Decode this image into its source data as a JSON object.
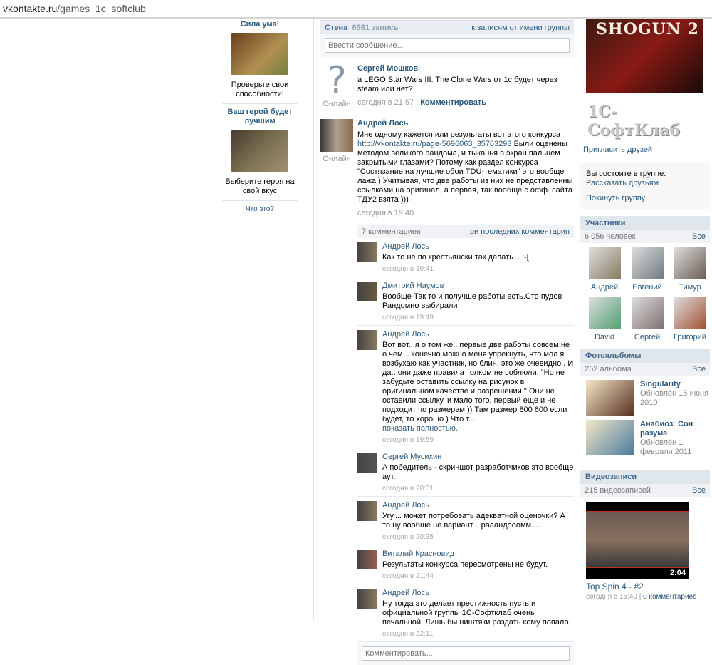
{
  "address_bar": {
    "host": "vkontakte.ru",
    "path": "/games_1c_softclub"
  },
  "ads": [
    {
      "title": "Сила ума!",
      "text": "Проверьте свои способности!",
      "color": "#8a7040"
    },
    {
      "title": "Ваш герой будет лучшим",
      "text": "Выберите героя на свой вкус",
      "color": "#5a5040"
    }
  ],
  "ads_help": "Что это?",
  "wall": {
    "title": "Стена",
    "count": "6981 запись",
    "group_posts_link": "к записям от имени группы",
    "input_placeholder": "Ввести сообщение...",
    "posts": [
      {
        "author": "Сергей Мошков",
        "status": "Онлайн",
        "avatar": "?",
        "text": "а LEGO Star Wars III: The Clone Wars от  1c будет через steam или нет?",
        "time": "сегодня в 21:57",
        "comment_link": "Комментировать"
      },
      {
        "author": "Андрей Лось",
        "status": "Онлайн",
        "text_before": "Мне одному кажется или результаты вот этого конкурса ",
        "link": "http://vkontakte.ru/page-5696063_35763293",
        "text_after": " Были оценены методом великого рандома, и тыканья в экран пальцем закрытыми глазами? Потому как раздел конкурса \"Состязание на лучшие обои TDU-тематики\" это вообще лажа ) Учитывая, что две работы из них не представленны ссылками на оригинал, а первая, так вообще с офф. сайта ТДУ2 взята )))",
        "time": "сегодня в 19:40"
      }
    ],
    "replies_header": {
      "count": "7 комментариев",
      "last_link": "три последних комментария"
    },
    "replies": [
      {
        "author": "Андрей Лось",
        "text": "Как то не по крестьянски так делать... :-[",
        "time": "сегодня в 19:41",
        "color": "#8a7a60"
      },
      {
        "author": "Дмитрий Наумов",
        "text": "Вообще Так то и получше работы есть.Сто пудов Рандомно выбирали",
        "time": "сегодня в 19:49",
        "color": "#6a5a40"
      },
      {
        "author": "Андрей Лось",
        "text": "Вот вот.. я о том же.. первые две работы совсем не о чем... конечно можно меня упрекнуть, что мол я возбухаю как участник, но блин, это же очевидно.. И да.. они даже правила толком не соблюли. \"Но не забудьте оставить ссылку на рисунок в оригинальном качестве и разрешении \" Они не оставили ссылку, и мало того, первый еще и не подходит по размерам )) Там размер 800 600 если будет, то хорошо ) Что т...",
        "more": "показать полностью..",
        "time": "сегодня в 19:59",
        "color": "#8a7a60"
      },
      {
        "author": "Сергей Мусихин",
        "text": "А победитель - скриншот разработчиков это вообще аут.",
        "time": "сегодня в 20:31",
        "color": "#555555"
      },
      {
        "author": "Андрей Лось",
        "text": "Угу.... может потребовать адекватной оценочки? А то ну вообще не вариант... рааандооомм....",
        "time": "сегодня в 20:35",
        "color": "#8a7a60"
      },
      {
        "author": "Виталий Красновид",
        "text": "Результаты конкурса пересмотрены не будут.",
        "time": "сегодня в 21:44",
        "color": "#9a6050"
      },
      {
        "author": "Андрей Лось",
        "text": "Ну тогда это делает престижность пусть и официальной группы 1С-Софтклаб очень печальной. Лишь бы ништяки раздать кому попало.",
        "time": "сегодня в 22:11",
        "color": "#8a7a60"
      }
    ],
    "comment_placeholder": "Комментировать..."
  },
  "right": {
    "logo_title": "SHOGUN 2",
    "logo_brand": "1С-СофтКлаб",
    "invite": "Пригласить друзей",
    "membership": {
      "status": "Вы состоите в группе.",
      "tell": "Рассказать друзьям",
      "leave": "Покинуть группу"
    },
    "members": {
      "title": "Участники",
      "count": "6 056 человек",
      "all": "Все",
      "items": [
        {
          "name": "Андрей",
          "color": "#8a7a60"
        },
        {
          "name": "Евгений",
          "color": "#707a80"
        },
        {
          "name": "Тимур",
          "color": "#6a5a50"
        },
        {
          "name": "David",
          "color": "#50a070"
        },
        {
          "name": "Сергей",
          "color": "#807070"
        },
        {
          "name": "Григорий",
          "color": "#a05030"
        }
      ]
    },
    "albums": {
      "title": "Фотоальбомы",
      "count": "252 альбома",
      "all": "Все",
      "items": [
        {
          "name": "Singularity",
          "updated": "Обновлён 15 июня 2010",
          "color": "#5a3020"
        },
        {
          "name": "Анабиоз: Сон разума",
          "updated": "Обновлён 1 февраля 2011",
          "color": "#4a7aa0"
        }
      ]
    },
    "videos": {
      "title": "Видеозаписи",
      "count": "215 видеозаписей",
      "all": "Все",
      "items": [
        {
          "title": "Top Spin 4 - #2",
          "duration": "2:04",
          "time": "сегодня в 15:40",
          "comments": "0 комментариев"
        }
      ]
    }
  }
}
